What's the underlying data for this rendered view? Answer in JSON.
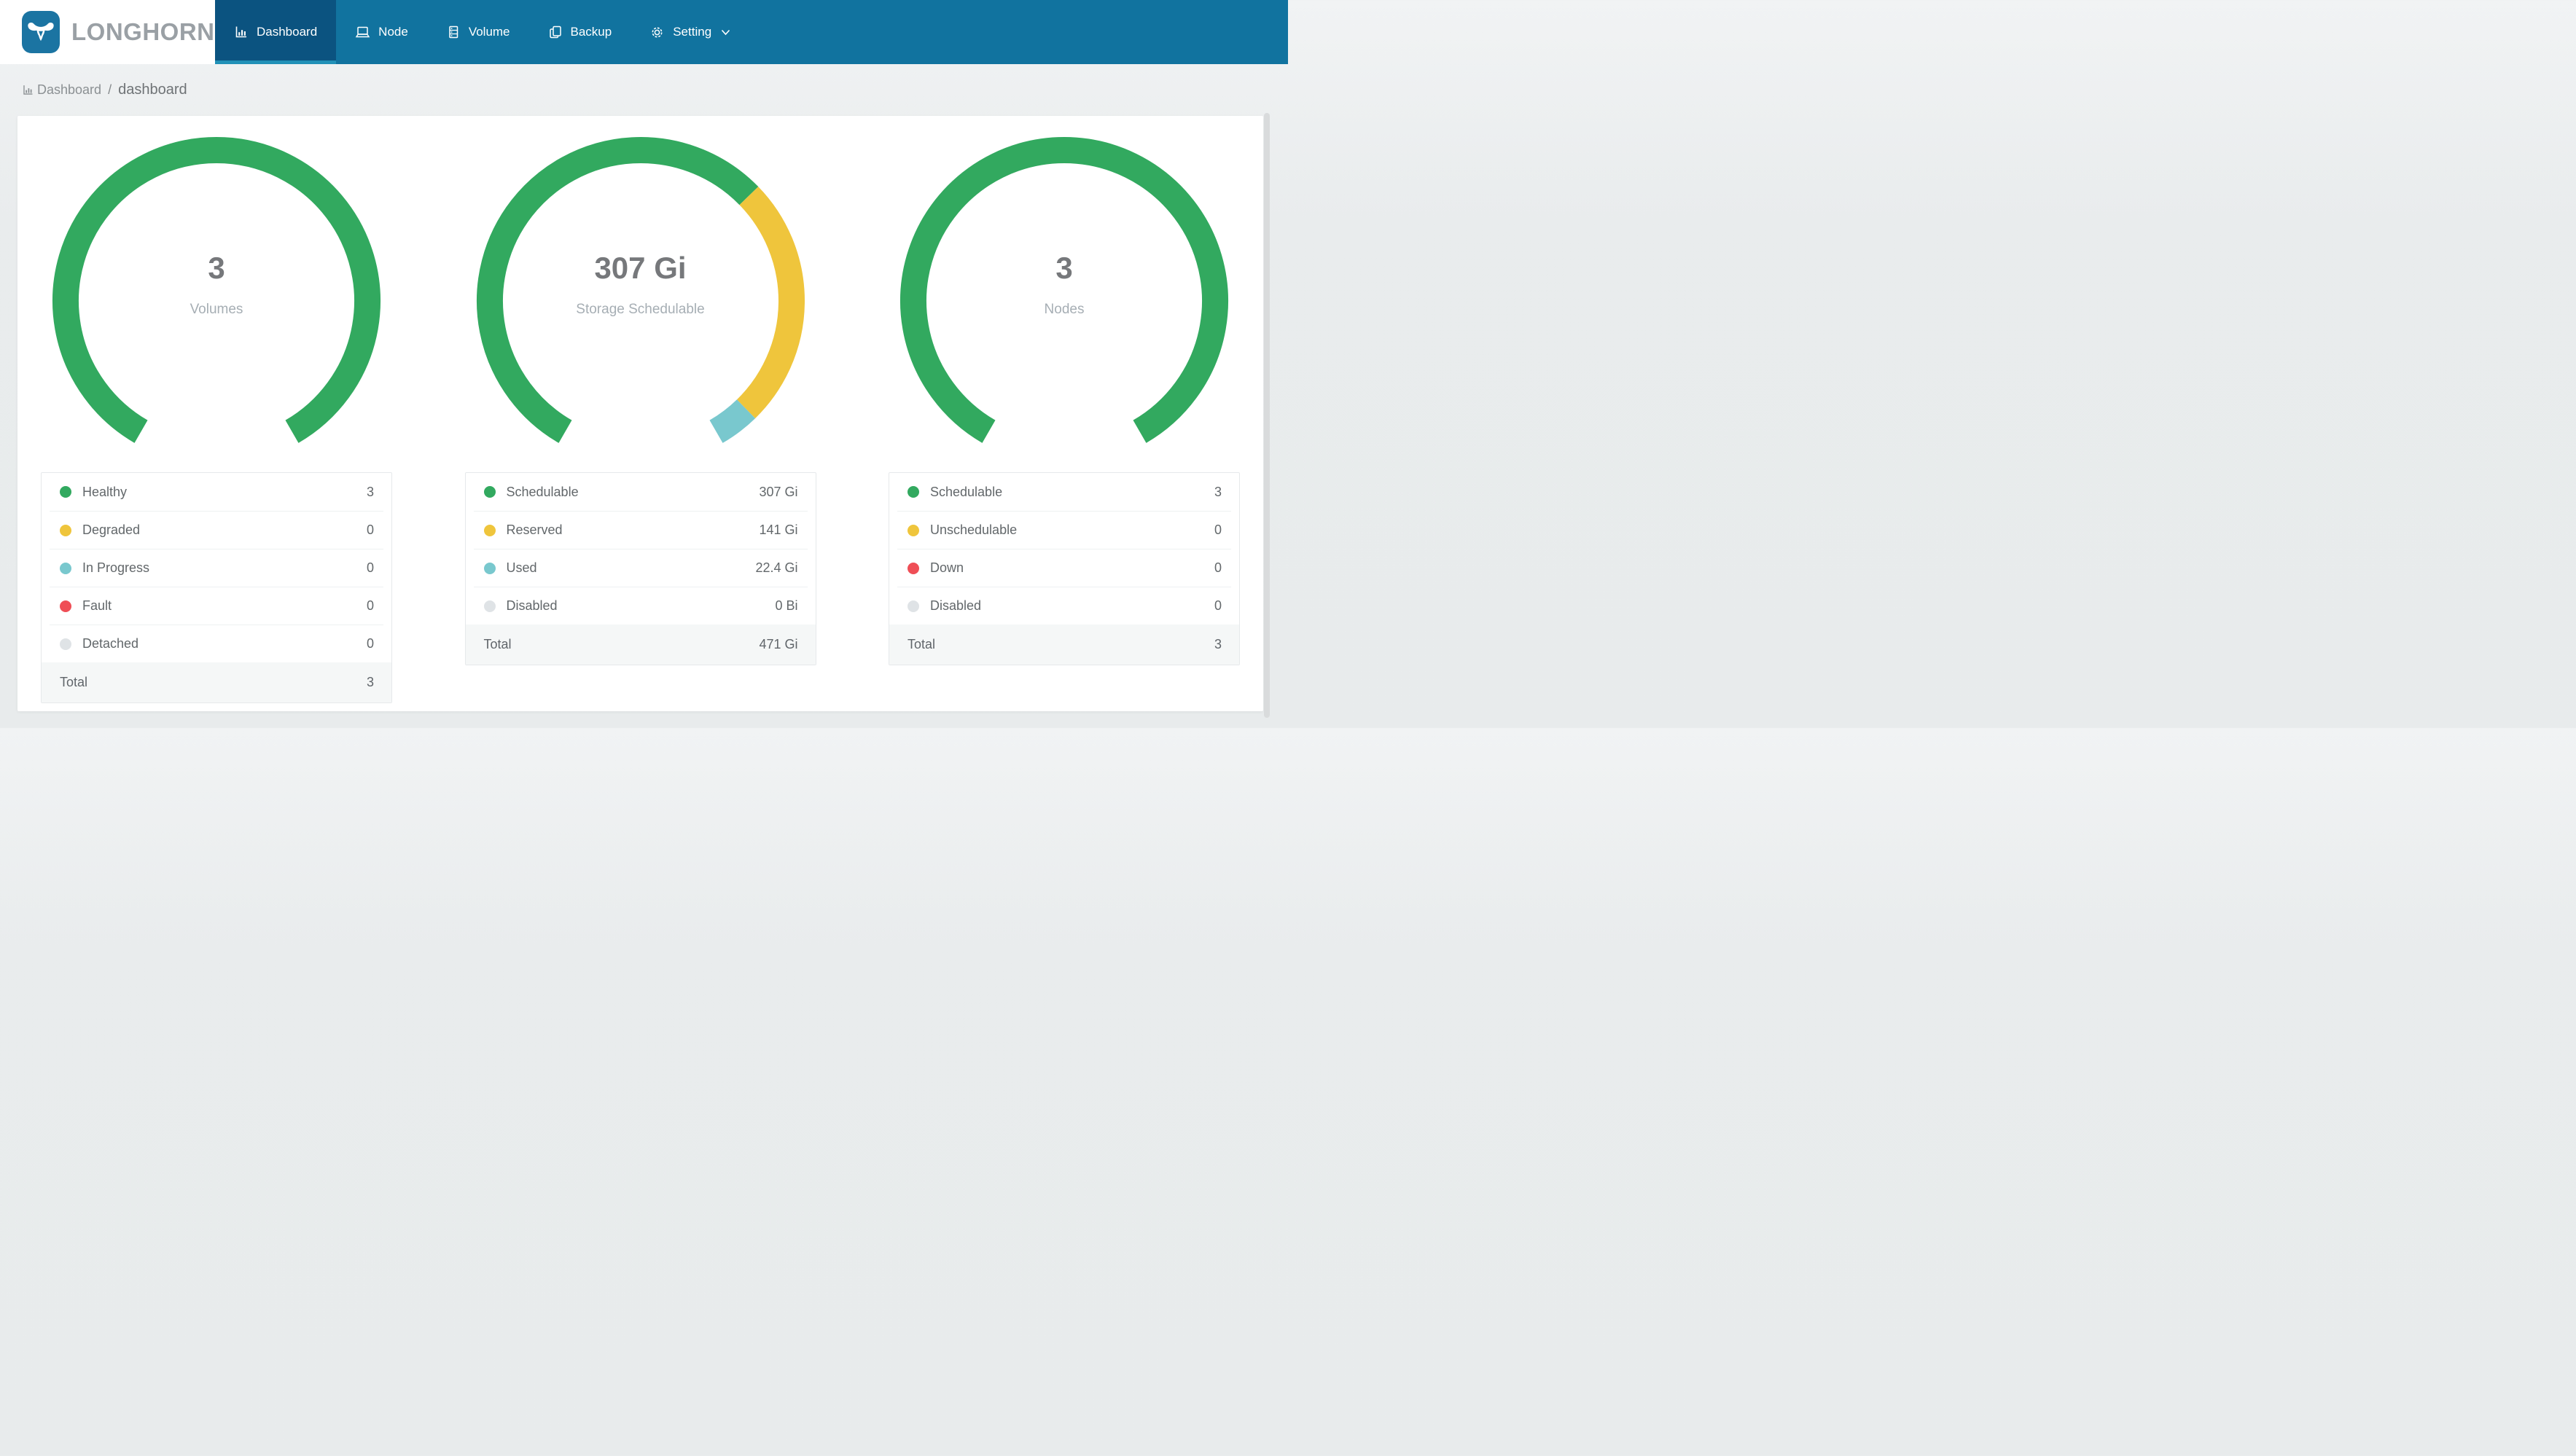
{
  "nav": {
    "logo_text": "LONGHORN",
    "items": [
      {
        "label": "Dashboard",
        "icon": "bar-chart-icon",
        "active": true
      },
      {
        "label": "Node",
        "icon": "laptop-icon",
        "active": false
      },
      {
        "label": "Volume",
        "icon": "storage-drawers-icon",
        "active": false
      },
      {
        "label": "Backup",
        "icon": "copy-icon",
        "active": false
      },
      {
        "label": "Setting",
        "icon": "gear-icon",
        "active": false,
        "has_dropdown": true
      }
    ]
  },
  "breadcrumb": {
    "section": "Dashboard",
    "page": "dashboard"
  },
  "colors": {
    "nav_bg": "#11739f",
    "nav_active_bg": "#0b5380",
    "nav_active_underline": "#2191b7",
    "logo_blue": "#1b74a2",
    "logo_text_gray": "#9aa0a5",
    "green": "#32a95f",
    "yellow": "#efc53c",
    "teal": "#79c8ce",
    "red": "#ef4e56",
    "gray": "#dfe3e6",
    "page_bg": "#e8ebec",
    "card_bg": "#ffffff"
  },
  "chart_data": [
    {
      "type": "gauge",
      "center_value": "3",
      "center_label": "Volumes",
      "start_angle": 120,
      "sweep": 300,
      "segments": [
        {
          "label": "Healthy",
          "value": 3,
          "display": "3",
          "color": "#32a95f"
        },
        {
          "label": "Degraded",
          "value": 0,
          "display": "0",
          "color": "#efc53c"
        },
        {
          "label": "In Progress",
          "value": 0,
          "display": "0",
          "color": "#79c8ce"
        },
        {
          "label": "Fault",
          "value": 0,
          "display": "0",
          "color": "#ef4e56"
        },
        {
          "label": "Detached",
          "value": 0,
          "display": "0",
          "color": "#dfe3e6"
        }
      ],
      "total_label": "Total",
      "total_value": 3,
      "total_display": "3"
    },
    {
      "type": "gauge",
      "center_value": "307 Gi",
      "center_label": "Storage Schedulable",
      "start_angle": 120,
      "sweep": 300,
      "segments": [
        {
          "label": "Schedulable",
          "value": 307,
          "display": "307 Gi",
          "color": "#32a95f"
        },
        {
          "label": "Reserved",
          "value": 141,
          "display": "141 Gi",
          "color": "#efc53c"
        },
        {
          "label": "Used",
          "value": 22.4,
          "display": "22.4 Gi",
          "color": "#79c8ce"
        },
        {
          "label": "Disabled",
          "value": 0,
          "display": "0 Bi",
          "color": "#dfe3e6"
        }
      ],
      "total_label": "Total",
      "total_value": 470.4,
      "total_display": "471 Gi"
    },
    {
      "type": "gauge",
      "center_value": "3",
      "center_label": "Nodes",
      "start_angle": 120,
      "sweep": 300,
      "segments": [
        {
          "label": "Schedulable",
          "value": 3,
          "display": "3",
          "color": "#32a95f"
        },
        {
          "label": "Unschedulable",
          "value": 0,
          "display": "0",
          "color": "#efc53c"
        },
        {
          "label": "Down",
          "value": 0,
          "display": "0",
          "color": "#ef4e56"
        },
        {
          "label": "Disabled",
          "value": 0,
          "display": "0",
          "color": "#dfe3e6"
        }
      ],
      "total_label": "Total",
      "total_value": 3,
      "total_display": "3"
    }
  ]
}
